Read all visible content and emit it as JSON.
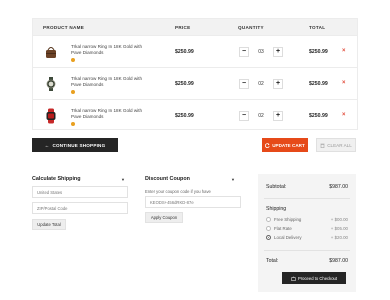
{
  "cart": {
    "headers": {
      "product": "PRODUCT NAME",
      "price": "PRICE",
      "quantity": "QUANTITY",
      "total": "TOTAL"
    },
    "items": [
      {
        "name": "Trkal narrow Ring In 18K Gold with Pave Diamonds",
        "price": "$250.99",
        "qty": "03",
        "total": "$250.99",
        "thumb": "handbag-icon"
      },
      {
        "name": "Trkal narrow Ring In 18K Gold with Pave Diamonds",
        "price": "$250.99",
        "qty": "02",
        "total": "$250.99",
        "thumb": "wristwatch-icon"
      },
      {
        "name": "Trkal narrow Ring In 18K Gold with Pave Diamonds",
        "price": "$250.99",
        "qty": "02",
        "total": "$250.99",
        "thumb": "smartwatch-icon"
      }
    ],
    "remove_glyph": "×",
    "minus_glyph": "−",
    "plus_glyph": "+"
  },
  "actions": {
    "continue": "CONTINUE SHOPPING",
    "continue_icon": "←",
    "update": "UPDATE CART",
    "clear": "CLEAR ALL"
  },
  "shipping_calc": {
    "title": "Calculate Shipping",
    "country": "United States",
    "zip_placeholder": "ZIP/Postal Code",
    "button": "Update Total"
  },
  "coupon": {
    "title": "Discount Coupon",
    "hint": "Enter your coupon code if you have",
    "code": "KEODS+456dRKD-87e",
    "button": "Apply Coupon"
  },
  "summary": {
    "subtotal_label": "Subtotal:",
    "subtotal": "$987.00",
    "shipping_label": "Shipping",
    "options": [
      {
        "label": "Free Shipping",
        "price": "+ $00.00",
        "selected": false
      },
      {
        "label": "Flat Rate",
        "price": "+ $05.00",
        "selected": false
      },
      {
        "label": "Local Delivery",
        "price": "+ $20.00",
        "selected": true
      }
    ],
    "total_label": "Total:",
    "total": "$987.00",
    "checkout": "Proceed to Checkout"
  },
  "colors": {
    "accent": "#e64a19",
    "dark": "#252525",
    "remove": "#e24b3a",
    "dot": "#e8a020"
  }
}
